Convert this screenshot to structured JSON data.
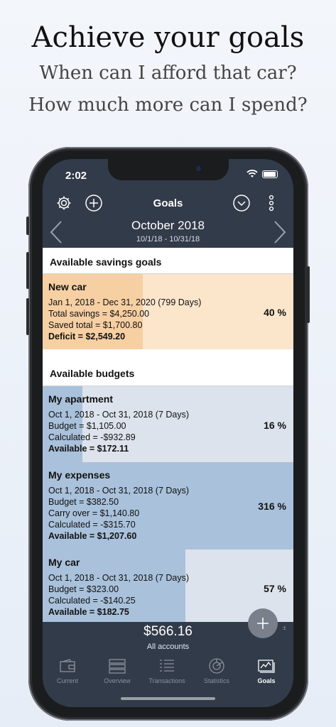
{
  "hero": {
    "title": "Achieve your goals",
    "line1": "When can I afford that car?",
    "line2": "How much more can I spend?"
  },
  "status": {
    "time": "2:02"
  },
  "nav": {
    "title": "Goals"
  },
  "period": {
    "month": "October 2018",
    "range": "10/1/18 - 10/31/18"
  },
  "savings_header": "Available savings goals",
  "savings": [
    {
      "name": "New car",
      "lines": [
        "Jan 1, 2018 - Dec 31, 2020 (799 Days)",
        "Total savings = $4,250.00",
        "Saved total = $1,700.80"
      ],
      "bold": "Deficit = $2,549.20",
      "percent": "40 %",
      "progress": 0.4
    }
  ],
  "budgets_header": "Available budgets",
  "budgets": [
    {
      "name": "My apartment",
      "lines": [
        "Oct 1, 2018 - Oct 31, 2018 (7 Days)",
        "Budget = $1,105.00",
        "Calculated = -$932.89"
      ],
      "bold": "Available = $172.11",
      "percent": "16 %",
      "progress": 0.16
    },
    {
      "name": "My expenses",
      "lines": [
        "Oct 1, 2018 - Oct 31, 2018 (7 Days)",
        "Budget = $382.50",
        "Carry over = $1,140.80",
        "Calculated = -$315.70"
      ],
      "bold": "Available = $1,207.60",
      "percent": "316 %",
      "progress": 1.0
    },
    {
      "name": "My car",
      "lines": [
        "Oct 1, 2018 - Oct 31, 2018 (7 Days)",
        "Budget = $323.00",
        "Calculated = -$140.25"
      ],
      "bold": "Available = $182.75",
      "percent": "57 %",
      "progress": 0.57
    }
  ],
  "footer": {
    "total": "$566.16",
    "subtitle": "All accounts",
    "fab_hint": "±"
  },
  "tabs": [
    {
      "label": "Current",
      "icon": "wallet-icon",
      "active": false
    },
    {
      "label": "Overview",
      "icon": "list-overview-icon",
      "active": false
    },
    {
      "label": "Transactions",
      "icon": "transactions-icon",
      "active": false
    },
    {
      "label": "Statistics",
      "icon": "pie-chart-icon",
      "active": false
    },
    {
      "label": "Goals",
      "icon": "goals-chart-icon",
      "active": true
    }
  ],
  "colors": {
    "savings_bg": "#fbe6cc",
    "savings_fill": "#f6cfa3",
    "budget_bg": "#dde3ec",
    "budget_fill": "#a9c1db",
    "bar": "#323b4a"
  }
}
